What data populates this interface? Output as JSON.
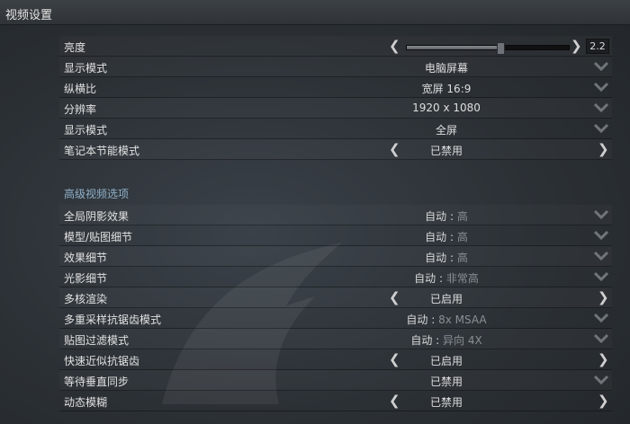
{
  "window": {
    "title": "视频设置"
  },
  "brightness": {
    "label": "亮度",
    "value": "2.2",
    "level": 0.58
  },
  "basic_rows": [
    {
      "label": "显示模式",
      "value": "电脑屏幕",
      "control": "dropdown"
    },
    {
      "label": "纵横比",
      "value": "宽屏 16:9",
      "control": "dropdown"
    },
    {
      "label": "分辨率",
      "value": "1920 x 1080",
      "control": "dropdown"
    },
    {
      "label": "显示模式",
      "value": "全屏",
      "control": "dropdown"
    },
    {
      "label": "笔记本节能模式",
      "value": "已禁用",
      "control": "stepper"
    }
  ],
  "advanced": {
    "header": "高级视频选项",
    "rows": [
      {
        "label": "全局阴影效果",
        "auto": "自动 :",
        "value": "高",
        "control": "dropdown"
      },
      {
        "label": "模型/贴图细节",
        "auto": "自动 :",
        "value": "高",
        "control": "dropdown"
      },
      {
        "label": "效果细节",
        "auto": "自动 :",
        "value": "高",
        "control": "dropdown"
      },
      {
        "label": "光影细节",
        "auto": "自动 :",
        "value": "非常高",
        "control": "dropdown"
      },
      {
        "label": "多核渲染",
        "value": "已启用",
        "control": "stepper"
      },
      {
        "label": "多重采样抗锯齿模式",
        "auto": "自动 :",
        "value": "8x MSAA",
        "control": "dropdown"
      },
      {
        "label": "贴图过滤模式",
        "auto": "自动 :",
        "value": "异向 4X",
        "control": "dropdown"
      },
      {
        "label": "快速近似抗锯齿",
        "value": "已启用",
        "control": "stepper"
      },
      {
        "label": "等待垂直同步",
        "value": "已禁用",
        "control": "dropdown"
      },
      {
        "label": "动态模糊",
        "value": "已禁用",
        "control": "stepper"
      }
    ]
  },
  "icons": {
    "left": "chevron-left-icon",
    "right": "chevron-right-icon",
    "dropdown": "chevron-down-icon"
  },
  "colors": {
    "accent_header": "#8fb0c8",
    "muted_value": "#8a8f94"
  }
}
